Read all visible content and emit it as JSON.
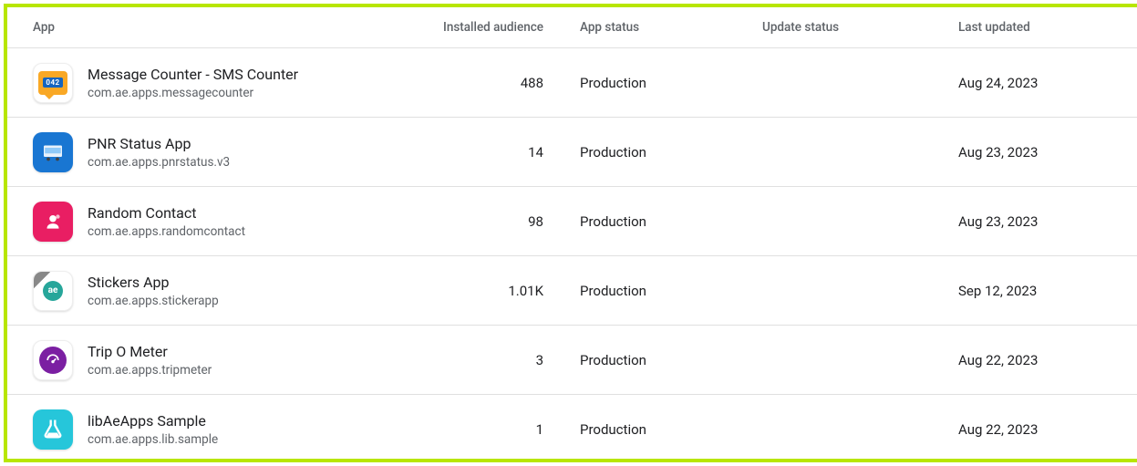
{
  "headers": {
    "app": "App",
    "audience": "Installed audience",
    "status": "App status",
    "update": "Update status",
    "updated": "Last updated"
  },
  "apps": [
    {
      "name": "Message Counter - SMS Counter",
      "package": "com.ae.apps.messagecounter",
      "audience": "488",
      "status": "Production",
      "update_status": "",
      "updated": "Aug 24, 2023",
      "icon_badge": "042"
    },
    {
      "name": "PNR Status App",
      "package": "com.ae.apps.pnrstatus.v3",
      "audience": "14",
      "status": "Production",
      "update_status": "",
      "updated": "Aug 23, 2023"
    },
    {
      "name": "Random Contact",
      "package": "com.ae.apps.randomcontact",
      "audience": "98",
      "status": "Production",
      "update_status": "",
      "updated": "Aug 23, 2023"
    },
    {
      "name": "Stickers App",
      "package": "com.ae.apps.stickerapp",
      "audience": "1.01K",
      "status": "Production",
      "update_status": "",
      "updated": "Sep 12, 2023",
      "icon_text": "ae"
    },
    {
      "name": "Trip O Meter",
      "package": "com.ae.apps.tripmeter",
      "audience": "3",
      "status": "Production",
      "update_status": "",
      "updated": "Aug 22, 2023"
    },
    {
      "name": "libAeApps Sample",
      "package": "com.ae.apps.lib.sample",
      "audience": "1",
      "status": "Production",
      "update_status": "",
      "updated": "Aug 22, 2023"
    }
  ]
}
